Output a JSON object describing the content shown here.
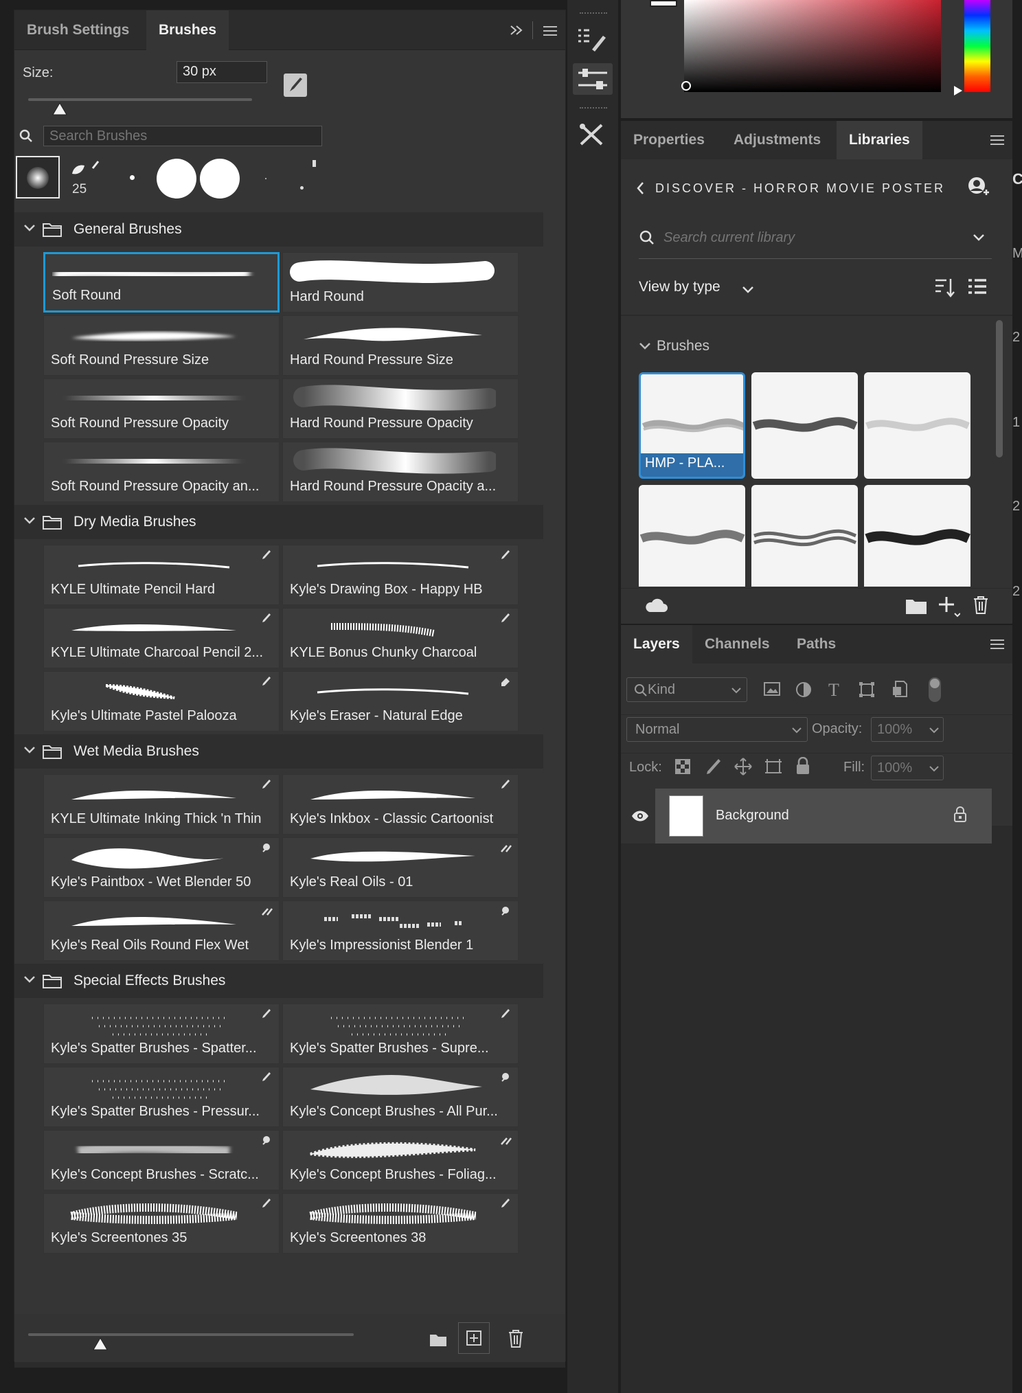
{
  "brush_panel": {
    "tabs": [
      "Brush Settings",
      "Brushes"
    ],
    "size_label": "Size:",
    "size_value": "30 px",
    "search_placeholder": "Search Brushes",
    "recent_count": "25",
    "groups": [
      {
        "name": "General Brushes",
        "brushes": [
          "Soft Round",
          "Hard Round",
          "Soft Round Pressure Size",
          "Hard Round Pressure Size",
          "Soft Round Pressure Opacity",
          "Hard Round Pressure Opacity",
          "Soft Round Pressure Opacity an...",
          "Hard Round Pressure Opacity a..."
        ]
      },
      {
        "name": "Dry Media Brushes",
        "brushes": [
          "KYLE Ultimate Pencil Hard",
          "Kyle's Drawing Box - Happy HB",
          "KYLE Ultimate Charcoal Pencil 2...",
          "KYLE Bonus Chunky Charcoal",
          "Kyle's Ultimate Pastel Palooza",
          "Kyle's Eraser - Natural Edge"
        ]
      },
      {
        "name": "Wet Media Brushes",
        "brushes": [
          "KYLE Ultimate Inking Thick 'n Thin",
          "Kyle's Inkbox - Classic Cartoonist",
          "Kyle's Paintbox - Wet Blender 50",
          "Kyle's Real Oils - 01",
          "Kyle's Real Oils Round Flex Wet",
          "Kyle's Impressionist Blender 1"
        ]
      },
      {
        "name": "Special Effects Brushes",
        "brushes": [
          "Kyle's Spatter Brushes - Spatter...",
          "Kyle's Spatter Brushes - Supre...",
          "Kyle's Spatter Brushes - Pressur...",
          "Kyle's Concept Brushes - All Pur...",
          "Kyle's Concept Brushes - Scratc...",
          "Kyle's Concept Brushes - Foliag...",
          "Kyle's Screentones 35",
          "Kyle's Screentones 38"
        ]
      }
    ]
  },
  "libraries_panel": {
    "tabs": [
      "Properties",
      "Adjustments",
      "Libraries"
    ],
    "breadcrumb": "DISCOVER - HORROR MOVIE POSTER",
    "search_placeholder": "Search current library",
    "view_by": "View by type",
    "section": "Brushes",
    "first_item_label": "HMP - PLA..."
  },
  "layers_panel": {
    "tabs": [
      "Layers",
      "Channels",
      "Paths"
    ],
    "kind": "Kind",
    "blend_mode": "Normal",
    "opacity_label": "Opacity:",
    "opacity_value": "100%",
    "lock_label": "Lock:",
    "fill_label": "Fill:",
    "fill_value": "100%",
    "layer_name": "Background"
  },
  "edge_glyphs": [
    "C",
    "M",
    "2",
    "1",
    "2",
    "2"
  ],
  "colors": {
    "accent": "#1e9ad6",
    "panel": "#353535",
    "header": "#2c2c2c"
  }
}
